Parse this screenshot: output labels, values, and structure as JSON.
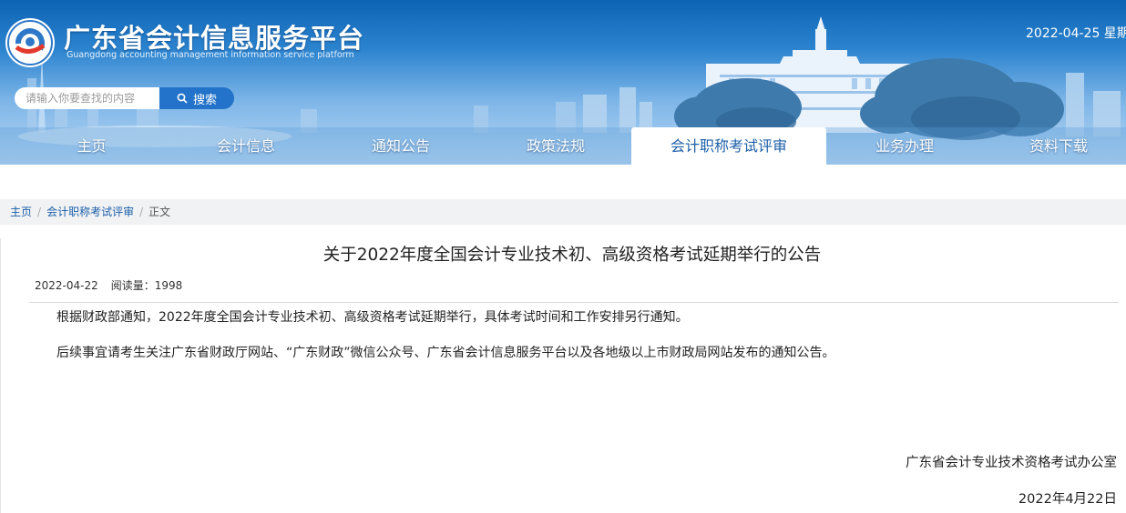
{
  "header": {
    "title": "广东省会计信息服务平台",
    "subtitle": "Guangdong accounting management information service platform",
    "date": "2022-04-25   星期",
    "logo_icon": "gd-accounting-logo"
  },
  "search": {
    "placeholder": "请输入你要查找的内容",
    "button_label": "搜索",
    "icon": "search-icon"
  },
  "nav": {
    "items": [
      {
        "label": "主页",
        "active": false
      },
      {
        "label": "会计信息",
        "active": false
      },
      {
        "label": "通知公告",
        "active": false
      },
      {
        "label": "政策法规",
        "active": false
      },
      {
        "label": "会计职称考试评审",
        "active": true
      },
      {
        "label": "业务办理",
        "active": false
      },
      {
        "label": "资料下载",
        "active": false
      }
    ]
  },
  "breadcrumb": {
    "home": "主页",
    "section": "会计职称考试评审",
    "current": "正文",
    "separator": "/"
  },
  "article": {
    "title": "关于2022年度全国会计专业技术初、高级资格考试延期举行的公告",
    "date": "2022-04-22",
    "views": "阅读量：1998",
    "paragraphs": [
      "根据财政部通知，2022年度全国会计专业技术初、高级资格考试延期举行，具体考试时间和工作安排另行通知。",
      "后续事宜请考生关注广东省财政厅网站、“广东财政”微信公众号、广东省会计信息服务平台以及各地级以上市财政局网站发布的通知公告。"
    ],
    "signature_org": "广东省会计专业技术资格考试办公室",
    "signature_date": "2022年4月22日"
  },
  "colors": {
    "banner_top": "#0d63b4",
    "banner_bottom": "#b8d8f4",
    "accent": "#1d5fa8",
    "search_button": "#2273c9",
    "breadcrumb_bg": "#f1f2f4"
  }
}
